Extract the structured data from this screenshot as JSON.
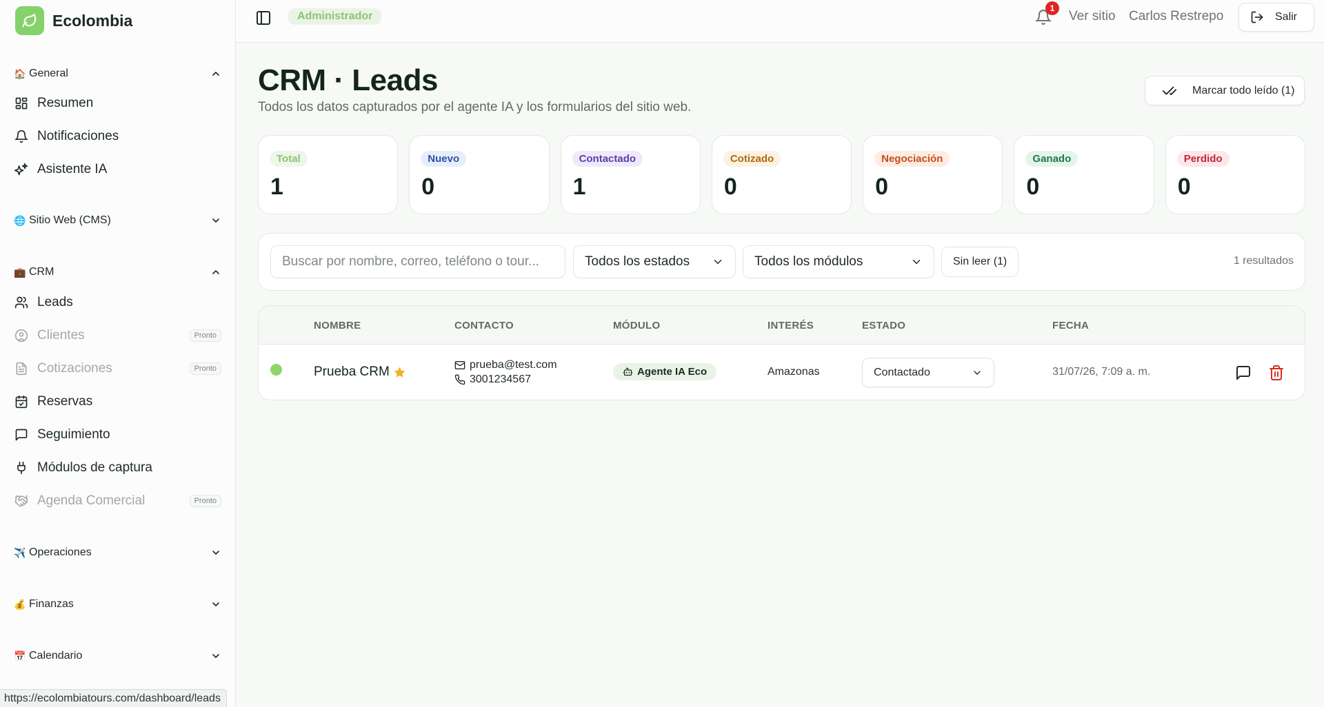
{
  "brand": {
    "name": "Ecolombia"
  },
  "sidebar": {
    "sections": [
      {
        "emoji": "🏠",
        "label": "General"
      },
      {
        "emoji": "🌐",
        "label": "Sitio Web (CMS)"
      },
      {
        "emoji": "💼",
        "label": "CRM"
      },
      {
        "emoji": "✈️",
        "label": "Operaciones"
      },
      {
        "emoji": "💰",
        "label": "Finanzas"
      },
      {
        "emoji": "📅",
        "label": "Calendario"
      }
    ],
    "items": [
      {
        "label": "Resumen"
      },
      {
        "label": "Notificaciones"
      },
      {
        "label": "Asistente IA"
      },
      {
        "label": "Leads"
      },
      {
        "label": "Clientes",
        "badge": "Pronto"
      },
      {
        "label": "Cotizaciones",
        "badge": "Pronto"
      },
      {
        "label": "Reservas"
      },
      {
        "label": "Seguimiento"
      },
      {
        "label": "Módulos de captura"
      },
      {
        "label": "Agenda Comercial",
        "badge": "Pronto"
      }
    ]
  },
  "topbar": {
    "role": "Administrador",
    "notification_count": "1",
    "view_site": "Ver sitio",
    "user_name": "Carlos Restrepo",
    "logout": "Salir"
  },
  "page": {
    "title": "CRM · Leads",
    "subtitle": "Todos los datos capturados por el agente IA y los formularios del sitio web.",
    "mark_all_read": "Marcar todo leído (1)"
  },
  "stats": [
    {
      "label": "Total",
      "value": "1",
      "color": "#8bc56f",
      "bg": "#eef6ea"
    },
    {
      "label": "Nuevo",
      "value": "0",
      "color": "#2f4ea8",
      "bg": "#e7eefb"
    },
    {
      "label": "Contactado",
      "value": "1",
      "color": "#5a3ea8",
      "bg": "#efeafb"
    },
    {
      "label": "Cotizado",
      "value": "0",
      "color": "#b06a12",
      "bg": "#fcf2e2"
    },
    {
      "label": "Negociación",
      "value": "0",
      "color": "#c2501a",
      "bg": "#fdece3"
    },
    {
      "label": "Ganado",
      "value": "0",
      "color": "#1f7a4a",
      "bg": "#e6f5ec"
    },
    {
      "label": "Perdido",
      "value": "0",
      "color": "#c0263a",
      "bg": "#fde7ea"
    }
  ],
  "filters": {
    "search_placeholder": "Buscar por nombre, correo, teléfono o tour...",
    "status_select": "Todos los estados",
    "module_select": "Todos los módulos",
    "unread": "Sin leer (1)",
    "results": "1 resultados"
  },
  "table": {
    "headers": [
      "NOMBRE",
      "CONTACTO",
      "MÓDULO",
      "INTERÉS",
      "ESTADO",
      "FECHA"
    ],
    "rows": [
      {
        "name": "Prueba CRM",
        "email": "prueba@test.com",
        "phone": "3001234567",
        "module": "Agente IA Eco",
        "interest": "Amazonas",
        "status": "Contactado",
        "date": "31/07/26, 7:09 a. m."
      }
    ]
  },
  "status_bar": {
    "url": "https://ecolombiatours.com/dashboard/leads"
  }
}
